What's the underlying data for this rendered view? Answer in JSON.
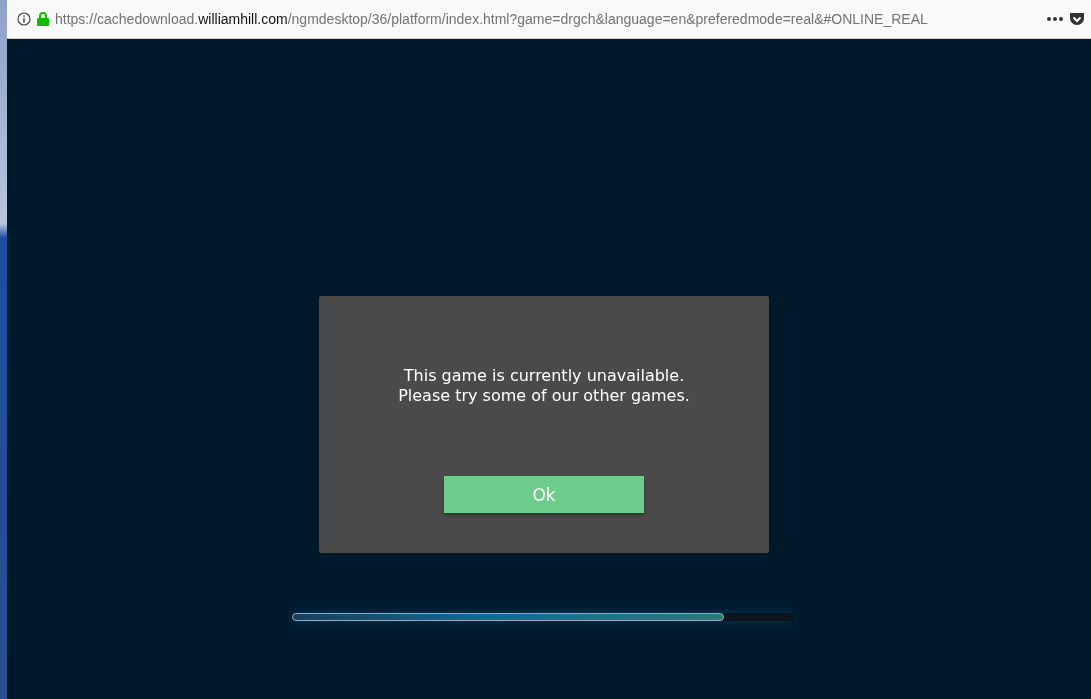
{
  "address_bar": {
    "url": "https://cachedownload.**williamhill.com**/ngmdesktop/36/platform/index.html?game=drgch&language=en&preferedmode=real&#ONLINE_REAL",
    "secure": true
  },
  "dialog": {
    "message": "This game is currently unavailable. Please try some of our other games.",
    "button": "Ok"
  },
  "loading_bar": {
    "level": 0.86
  }
}
